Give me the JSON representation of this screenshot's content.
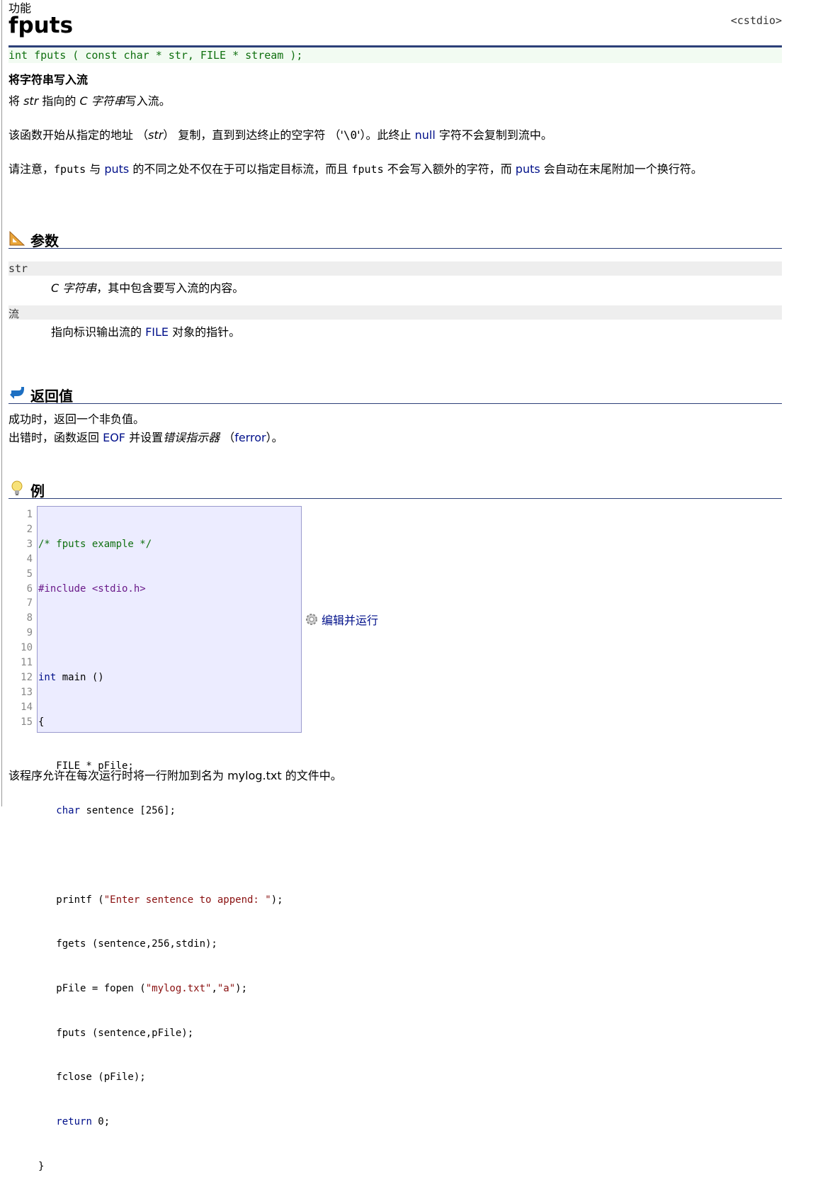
{
  "breadcrumb_top": "功能",
  "page_title": "fputs",
  "header_tag": "<cstdio>",
  "prototype": "int fputs ( const char * str, FILE * stream );",
  "brief": "将字符串写入流",
  "intro": {
    "p1": [
      "将 ",
      "str",
      " 指向的 ",
      "C 字符串",
      "写入流。"
    ],
    "p2": [
      "该函数开始从指定的地址 （",
      "str",
      "） 复制，直到到达终止的空字符 （'",
      "\\0",
      "'）。此终止 ",
      "null",
      " 字符不会复制到流中。"
    ],
    "p3": [
      "请注意，",
      "fputs",
      " 与 ",
      "puts",
      " 的不同之处不仅在于可以指定目标流，而且 ",
      "fputs",
      " 不会写入额外的字符，而 ",
      "puts",
      " 会自动在末尾附加一个换行符。"
    ]
  },
  "sections": {
    "params": "参数",
    "return_value": "返回值",
    "example": "例"
  },
  "params": [
    {
      "name": "str",
      "desc_parts": [
        "C 字符串",
        "，其中包含要写入流的内容。"
      ]
    },
    {
      "name": "流",
      "desc_parts": [
        "指向标识输出流的 ",
        "FILE",
        " 对象的指针。"
      ]
    }
  ],
  "return": {
    "line1": "成功时，返回一个非负值。",
    "line2": [
      "出错时，函数返回 ",
      "EOF",
      " 并设置",
      "错误指示器",
      " （",
      "ferror",
      "）。"
    ]
  },
  "code": {
    "line_numbers": [
      "1",
      "2",
      "3",
      "4",
      "5",
      "6",
      "7",
      "8",
      "9",
      "10",
      "11",
      "12",
      "13",
      "14",
      "15"
    ],
    "lines": [
      "/* fputs example */",
      "#include <stdio.h>",
      "",
      "int main ()",
      "{",
      "   FILE * pFile;",
      "   char sentence [256];",
      "",
      "   printf (\"Enter sentence to append: \");",
      "   fgets (sentence,256,stdin);",
      "   pFile = fopen (\"mylog.txt\",\"a\");",
      "   fputs (sentence,pFile);",
      "   fclose (pFile);",
      "   return 0;",
      "}"
    ]
  },
  "run_button": "编辑并运行",
  "footer_text": [
    "该程序允许在每次运行时将一行附加到名为 ",
    "mylog.txt",
    " 的文件中。"
  ],
  "icons": [
    "ruler-icon",
    "return-arrow-icon",
    "lightbulb-icon",
    "gear-icon"
  ]
}
